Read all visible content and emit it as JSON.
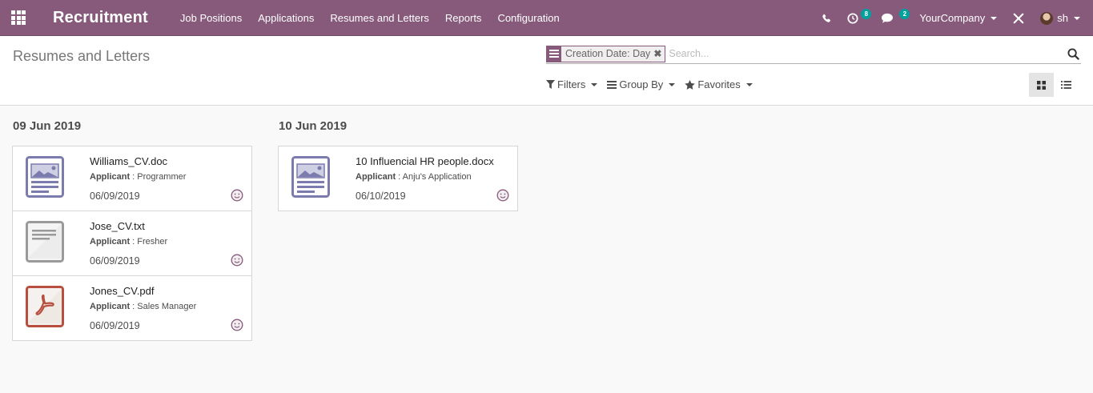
{
  "navbar": {
    "brand": "Recruitment",
    "menu": [
      "Job Positions",
      "Applications",
      "Resumes and Letters",
      "Reports",
      "Configuration"
    ],
    "activities_count": "8",
    "messages_count": "2",
    "company": "YourCompany",
    "user": "sh"
  },
  "control_panel": {
    "breadcrumb": "Resumes and Letters",
    "facet": "Creation Date: Day",
    "facet_close": "✖",
    "search_placeholder": "Search...",
    "filters_label": "Filters",
    "group_by_label": "Group By",
    "favorites_label": "Favorites"
  },
  "columns": [
    {
      "title": "09 Jun 2019",
      "cards": [
        {
          "name": "Williams_CV.doc",
          "applicant_label": "Applicant",
          "applicant": " : Programmer",
          "date": "06/09/2019",
          "type": "image-doc-icon"
        },
        {
          "name": "Jose_CV.txt",
          "applicant_label": "Applicant",
          "applicant": " : Fresher",
          "date": "06/09/2019",
          "type": "text-doc-icon"
        },
        {
          "name": "Jones_CV.pdf",
          "applicant_label": "Applicant",
          "applicant": " : Sales Manager",
          "date": "06/09/2019",
          "type": "pdf-icon"
        }
      ]
    },
    {
      "title": "10 Jun 2019",
      "cards": [
        {
          "name": "10 Influencial HR people.docx",
          "applicant_label": "Applicant",
          "applicant": " : Anju's Application",
          "date": "06/10/2019",
          "type": "image-doc-icon"
        }
      ]
    }
  ],
  "colors": {
    "navbar": "#875a7b",
    "badge": "#00a09d",
    "doc_icon": "#7c7bad",
    "pdf_icon": "#b84e3e"
  }
}
